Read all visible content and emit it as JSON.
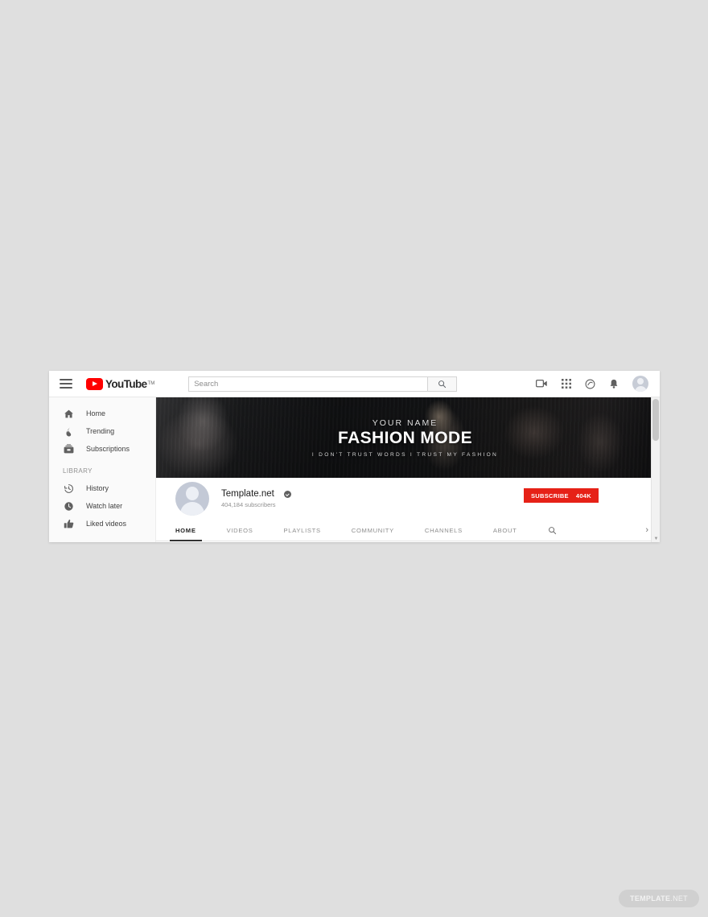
{
  "page": {
    "background_color": "#dfdfdf",
    "watermark_strong": "TEMPLATE",
    "watermark_light": ".NET"
  },
  "header": {
    "menu_icon": "hamburger-icon",
    "logo_word": "YouTube",
    "logo_tm": "TM",
    "search": {
      "placeholder": "Search",
      "value": "",
      "button_icon": "search-icon"
    },
    "icons": [
      {
        "name": "create-video-icon",
        "label": "Create"
      },
      {
        "name": "apps-grid-icon",
        "label": "YouTube apps"
      },
      {
        "name": "messages-icon",
        "label": "Messages"
      },
      {
        "name": "notifications-bell-icon",
        "label": "Notifications"
      },
      {
        "name": "account-avatar",
        "label": "Account"
      }
    ]
  },
  "sidebar": {
    "primary": [
      {
        "label": "Home",
        "icon": "home-icon"
      },
      {
        "label": "Trending",
        "icon": "trending-flame-icon"
      },
      {
        "label": "Subscriptions",
        "icon": "subscriptions-icon"
      }
    ],
    "library_title": "LIBRARY",
    "library": [
      {
        "label": "History",
        "icon": "history-clock-icon"
      },
      {
        "label": "Watch later",
        "icon": "watch-later-clock-icon"
      },
      {
        "label": "Liked videos",
        "icon": "thumbs-up-icon"
      }
    ]
  },
  "banner": {
    "your_name": "YOUR NAME",
    "title": "FASHION MODE",
    "tagline": "I DON'T TRUST WORDS I TRUST MY FASHION"
  },
  "channel": {
    "avatar": "channel-avatar",
    "name": "Template.net",
    "verified_icon": "verified-badge-icon",
    "subscribers": "404,184 subscribers",
    "subscribe_label": "SUBSCRIBE",
    "subscribe_count": "404K",
    "subscribe_color": "#e62117"
  },
  "tabs": {
    "items": [
      {
        "label": "HOME",
        "active": true
      },
      {
        "label": "VIDEOS",
        "active": false
      },
      {
        "label": "PLAYLISTS",
        "active": false
      },
      {
        "label": "COMMUNITY",
        "active": false
      },
      {
        "label": "CHANNELS",
        "active": false
      },
      {
        "label": "ABOUT",
        "active": false
      }
    ],
    "search_icon": "tab-search-icon",
    "overflow_chevron": "›"
  },
  "scrollbar": {
    "up_arrow": "▲",
    "down_arrow": "▼"
  }
}
